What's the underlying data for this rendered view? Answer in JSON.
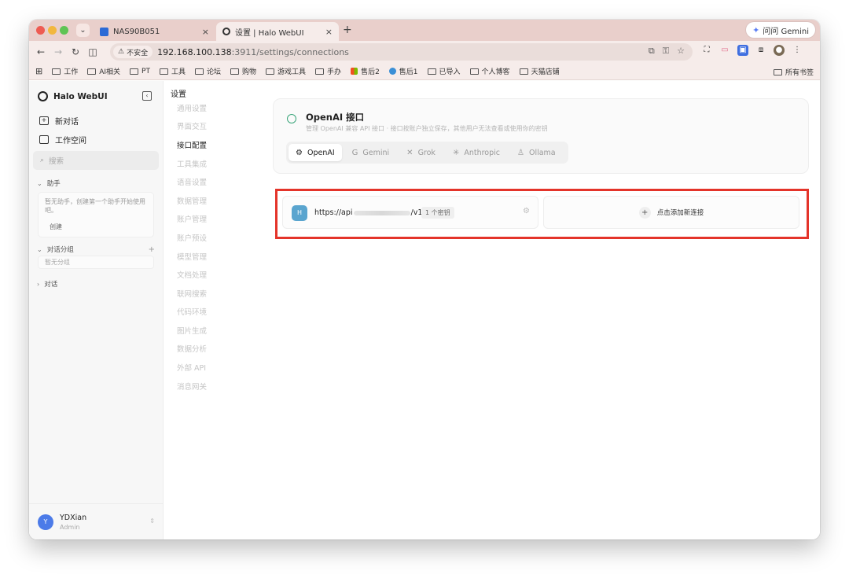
{
  "browser": {
    "tabs": [
      {
        "title": "NAS90B051",
        "close": "×"
      },
      {
        "title": "设置 | Halo WebUI",
        "close": "×"
      }
    ],
    "new_tab": "+",
    "gemini_label": "问问 Gemini",
    "insecure_label": "不安全",
    "url_host": "192.168.100.138",
    "url_path": ":3911/settings/connections",
    "bookmarks": [
      "工作",
      "AI相关",
      "PT",
      "工具",
      "论坛",
      "购物",
      "游戏工具",
      "手办",
      "售后2",
      "售后1",
      "已导入",
      "个人博客",
      "天猫店铺"
    ],
    "all_bookmarks": "所有书签",
    "colors": {
      "tabstrip": "#e9cfcb",
      "toolbar": "#f6ecea"
    }
  },
  "sidebar": {
    "brand": "Halo WebUI",
    "new_chat": "新对话",
    "workspace": "工作空间",
    "search_placeholder": "搜索",
    "assistant_group": "助手",
    "assistant_empty": "暂无助手，创建第一个助手开始使用吧。",
    "create_label": "创建",
    "chat_groups": "对话分组",
    "groups_empty": "暂无分组",
    "chats": "对话",
    "user": {
      "initial": "Y",
      "name": "YDXian",
      "role": "Admin"
    }
  },
  "settings_nav": {
    "title": "设置",
    "items": [
      "通用设置",
      "界面交互",
      "接口配置",
      "工具集成",
      "语音设置",
      "数据管理",
      "账户管理",
      "账户预设",
      "模型管理",
      "文档处理",
      "联网搜索",
      "代码环境",
      "图片生成",
      "数据分析",
      "外部 API",
      "消息网关"
    ],
    "active_index": 2
  },
  "provider": {
    "title": "OpenAI 接口",
    "description": "管理 OpenAI 兼容 API 接口 · 接口按账户独立保存，其他用户无法查看或使用你的密钥",
    "tabs": [
      {
        "label": "OpenAI",
        "icon": "openai-icon",
        "glyph": "⚙"
      },
      {
        "label": "Gemini",
        "icon": "gemini-icon",
        "glyph": "G"
      },
      {
        "label": "Grok",
        "icon": "grok-icon",
        "glyph": "✕"
      },
      {
        "label": "Anthropic",
        "icon": "anthropic-icon",
        "glyph": "✳"
      },
      {
        "label": "Ollama",
        "icon": "ollama-icon",
        "glyph": "♙"
      }
    ],
    "active_tab": 0
  },
  "connections": [
    {
      "initial": "H",
      "url_prefix": "https://api",
      "url_suffix": "/v1",
      "keys": "1 个密钥"
    }
  ],
  "add_connection": "点击添加新连接",
  "colors": {
    "highlight": "#e4342a",
    "avatar": "#4c7be8",
    "conn_avatar": "#5aa5cf"
  }
}
